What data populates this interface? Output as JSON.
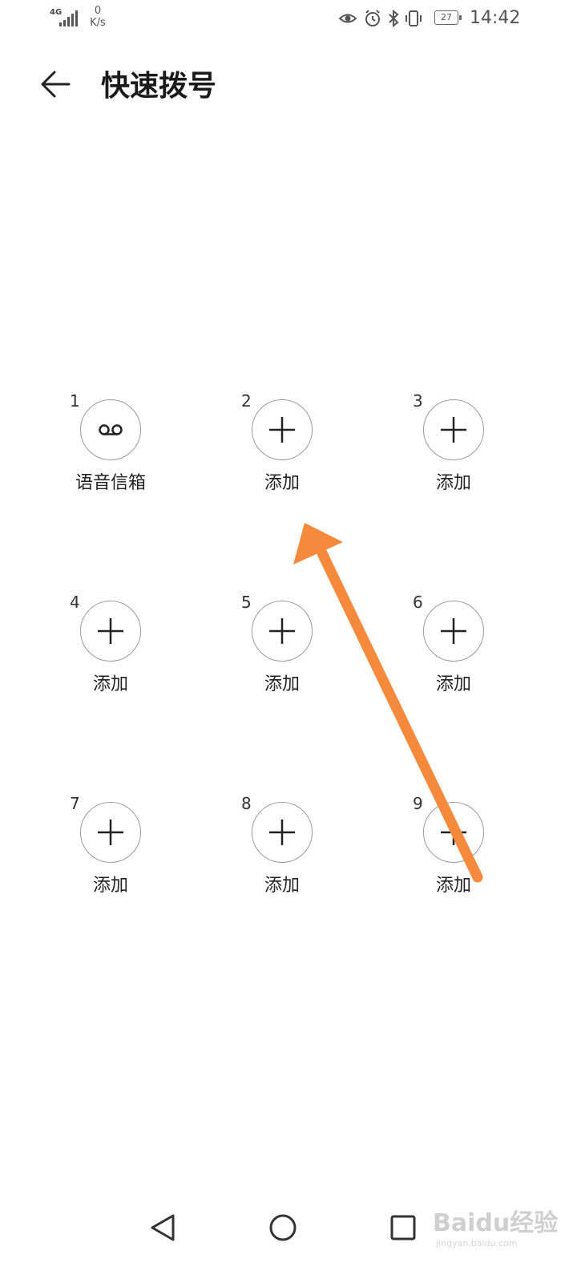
{
  "status_bar": {
    "network": "4G",
    "speed_value": "0",
    "speed_unit": "K/s",
    "battery": "27",
    "time": "14:42",
    "icons": [
      "eye-icon",
      "alarm-icon",
      "bluetooth-icon",
      "vibrate-icon"
    ]
  },
  "header": {
    "back_icon": "back-arrow-icon",
    "title": "快速拨号"
  },
  "speed_dial": [
    {
      "number": "1",
      "label": "语音信箱",
      "icon": "voicemail-icon"
    },
    {
      "number": "2",
      "label": "添加",
      "icon": "plus-icon"
    },
    {
      "number": "3",
      "label": "添加",
      "icon": "plus-icon"
    },
    {
      "number": "4",
      "label": "添加",
      "icon": "plus-icon"
    },
    {
      "number": "5",
      "label": "添加",
      "icon": "plus-icon"
    },
    {
      "number": "6",
      "label": "添加",
      "icon": "plus-icon"
    },
    {
      "number": "7",
      "label": "添加",
      "icon": "plus-icon"
    },
    {
      "number": "8",
      "label": "添加",
      "icon": "plus-icon"
    },
    {
      "number": "9",
      "label": "添加",
      "icon": "plus-icon"
    }
  ],
  "annotation": {
    "color": "#f58a3c"
  },
  "nav_bar": {
    "icons": [
      "back-triangle-icon",
      "home-circle-icon",
      "recents-square-icon"
    ]
  },
  "watermark": {
    "text": "Baidu经验",
    "sub": "jingyan.baidu.com"
  }
}
